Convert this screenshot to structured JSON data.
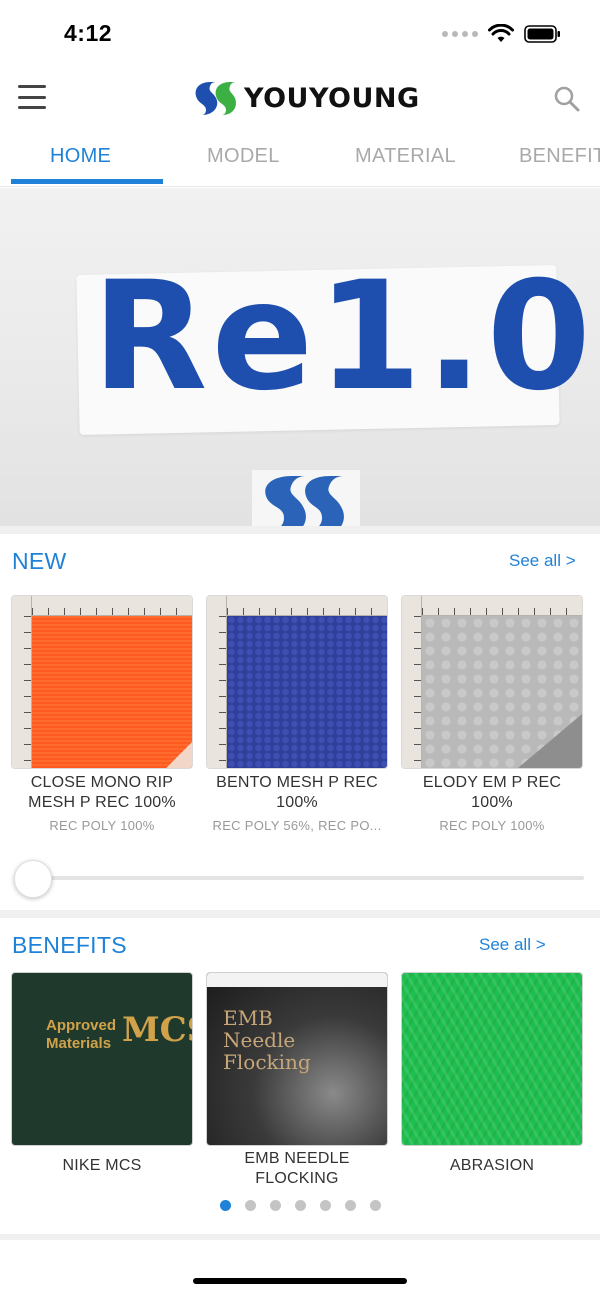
{
  "status_bar": {
    "time": "4:12"
  },
  "header": {
    "logo_text": "YOUYOUNG"
  },
  "tabs": [
    {
      "label": "HOME"
    },
    {
      "label": "MODEL"
    },
    {
      "label": "MATERIAL"
    },
    {
      "label": "BENEFIT"
    }
  ],
  "active_tab": "HOME",
  "banner": {
    "text": "Re1.0"
  },
  "new_section": {
    "title": "NEW",
    "see_all": "See all >",
    "items": [
      {
        "title": "CLOSE MONO RIP MESH P REC 100%",
        "subtitle": "REC POLY 100%",
        "color": "#ff5a1f"
      },
      {
        "title": "BENTO MESH P REC 100%",
        "subtitle": "REC POLY 56%, REC PO...",
        "color": "#2f3f9a"
      },
      {
        "title": "ELODY EM P REC 100%",
        "subtitle": "REC POLY 100%",
        "color": "#b8b8b8"
      }
    ],
    "scroll_position": 0
  },
  "benefits_section": {
    "title": "BENEFITS",
    "see_all": "See all >",
    "items": [
      {
        "title": "NIKE MCS",
        "image_text_1": "Approved",
        "image_text_2": "Materials",
        "image_letters": "MCS",
        "color": "#1f3a2c"
      },
      {
        "title": "EMB NEEDLE FLOCKING",
        "image_text_1": "EMB",
        "image_text_2": "Needle",
        "image_text_3": "Flocking",
        "color": "#2a2a2a"
      },
      {
        "title": "ABRASION",
        "color": "#1fbf4f"
      }
    ],
    "page_count": 7,
    "active_page": 1
  },
  "colors": {
    "accent": "#1f82d8",
    "logo_blue": "#1f4fae",
    "logo_green": "#3cb043"
  }
}
